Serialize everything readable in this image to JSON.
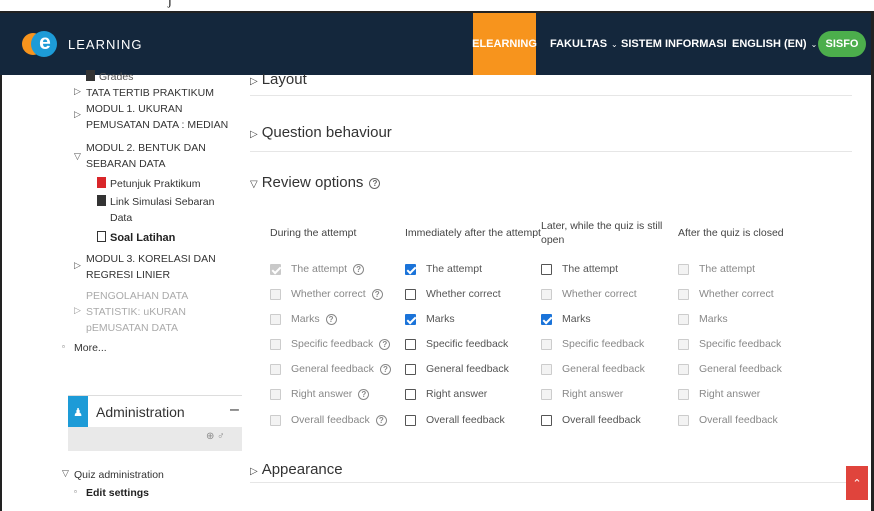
{
  "top_strip": {
    "text": "j"
  },
  "brand": {
    "logo_letter": "e",
    "logo_text": "LEARNING"
  },
  "nav": [
    {
      "label": "ELEARNING",
      "has_menu": false
    },
    {
      "label": "FAKULTAS",
      "has_menu": true
    },
    {
      "label": "SISTEM INFORMASI",
      "has_menu": true
    },
    {
      "label": "ENGLISH (EN)",
      "has_menu": true
    }
  ],
  "nav_chev": "⌄",
  "sisfo": "SISFO",
  "sidebar": {
    "items": [
      {
        "label": "Grades"
      },
      {
        "label": "TATA TERTIB PRAKTIKUM"
      },
      {
        "label": "MODUL 1. UKURAN"
      },
      {
        "label": "PEMUSATAN DATA : MEDIAN"
      },
      {
        "label": "MODUL 2. BENTUK DAN"
      },
      {
        "label": "SEBARAN DATA"
      },
      {
        "label": "Petunjuk Praktikum"
      },
      {
        "label": "Link Simulasi Sebaran"
      },
      {
        "label": "Data"
      },
      {
        "label": "Soal Latihan"
      },
      {
        "label": "MODUL 3. KORELASI DAN"
      },
      {
        "label": "REGRESI LINIER"
      },
      {
        "label": "PENGOLAHAN DATA"
      },
      {
        "label": "STATISTIK: uKURAN"
      },
      {
        "label": "pEMUSATAN DATA"
      },
      {
        "label": "More..."
      }
    ],
    "admin_title": "Administration",
    "admin_minimize": "–",
    "admin_tools": "⊕ ♂",
    "quiz_admin": "Quiz administration",
    "edit_settings": "Edit settings"
  },
  "sections": {
    "layout": "Layout",
    "question_behaviour": "Question behaviour",
    "review_options": "Review options",
    "appearance": "Appearance"
  },
  "review": {
    "columns": [
      "During the attempt",
      "Immediately after the attempt",
      "Later, while the quiz is still open",
      "After the quiz is closed"
    ],
    "options": [
      "The attempt",
      "Whether correct",
      "Marks",
      "Specific feedback",
      "General feedback",
      "Right answer",
      "Overall feedback"
    ],
    "states": [
      [
        "checked-disabled",
        "disabled",
        "disabled",
        "disabled",
        "disabled",
        "disabled",
        "disabled"
      ],
      [
        "checked",
        "unchecked",
        "checked",
        "unchecked",
        "unchecked",
        "unchecked",
        "unchecked"
      ],
      [
        "unchecked",
        "disabled",
        "checked",
        "disabled",
        "disabled",
        "disabled",
        "unchecked"
      ],
      [
        "disabled",
        "disabled",
        "disabled",
        "disabled",
        "disabled",
        "disabled",
        "disabled"
      ]
    ]
  },
  "icons": {
    "help": "?",
    "collapsed_arrow": "▷",
    "expanded_arrow": "▽",
    "bullet": "▫",
    "admin": "♟",
    "scroll_top": "⌃"
  },
  "colors": {
    "navbar": "#14273c",
    "active_nav": "#f7941d",
    "sisfo": "#4cae4c",
    "checkbox_checked": "#1a73d9",
    "admin_icon": "#1d9bd7",
    "scroll_button": "#e0443c"
  }
}
